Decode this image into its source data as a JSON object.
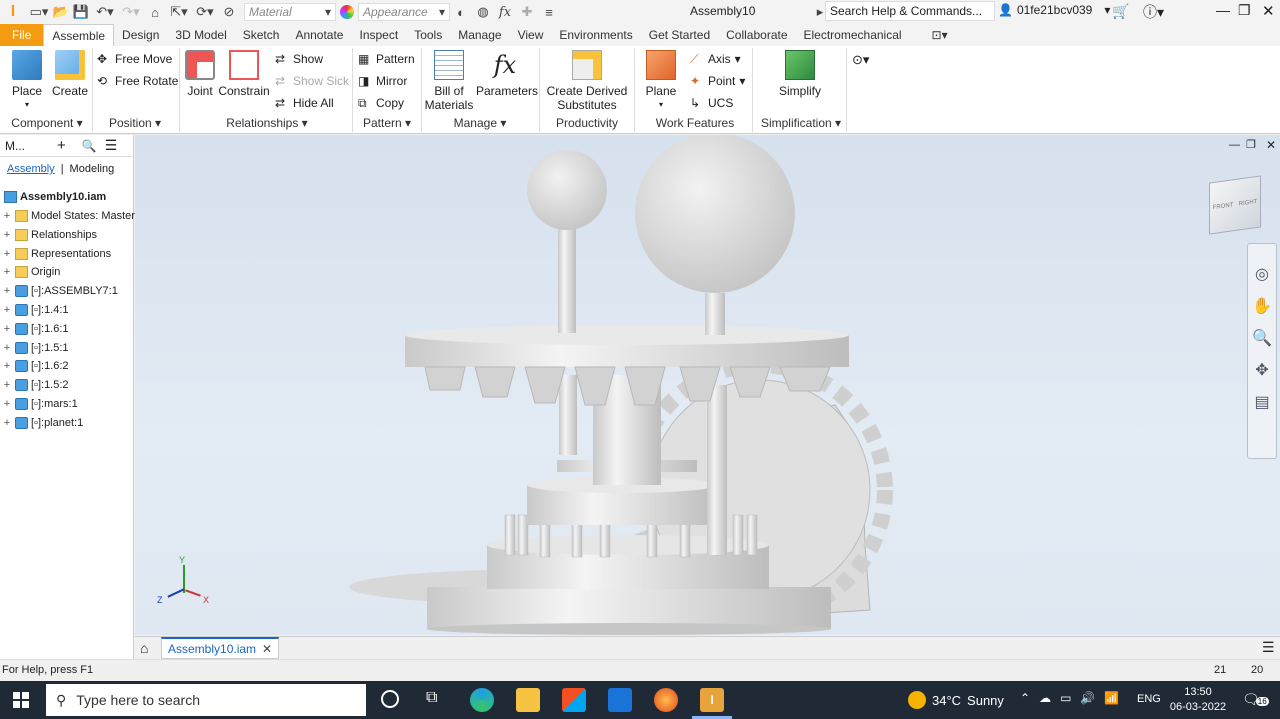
{
  "titlebar": {
    "material_placeholder": "Material",
    "appearance_placeholder": "Appearance",
    "document_title": "Assembly10",
    "search_placeholder": "Search Help & Commands...",
    "username": "01fe21bcv039"
  },
  "tabs": [
    "File",
    "Assemble",
    "Design",
    "3D Model",
    "Sketch",
    "Annotate",
    "Inspect",
    "Tools",
    "Manage",
    "View",
    "Environments",
    "Get Started",
    "Collaborate",
    "Electromechanical"
  ],
  "ribbon": {
    "component": {
      "place": "Place",
      "create": "Create",
      "group": "Component"
    },
    "position": {
      "free_move": "Free Move",
      "free_rotate": "Free Rotate",
      "group": "Position"
    },
    "relationships": {
      "joint": "Joint",
      "constrain": "Constrain",
      "show": "Show",
      "show_sick": "Show Sick",
      "hide_all": "Hide All",
      "group": "Relationships"
    },
    "pattern": {
      "pattern": "Pattern",
      "mirror": "Mirror",
      "copy": "Copy",
      "group": "Pattern"
    },
    "manage": {
      "bom_line1": "Bill of",
      "bom_line2": "Materials",
      "parameters": "Parameters",
      "group": "Manage"
    },
    "productivity": {
      "line1": "Create Derived",
      "line2": "Substitutes",
      "group": "Productivity"
    },
    "work_features": {
      "plane": "Plane",
      "axis": "Axis",
      "point": "Point",
      "ucs": "UCS",
      "group": "Work Features"
    },
    "simplification": {
      "simplify": "Simplify",
      "group": "Simplification"
    }
  },
  "browser": {
    "title": "M...",
    "tab_assembly": "Assembly",
    "tab_modeling": "Modeling",
    "root": "Assembly10.iam",
    "items": [
      {
        "label": "Model States: Master",
        "type": "folder"
      },
      {
        "label": "Relationships",
        "type": "folder"
      },
      {
        "label": "Representations",
        "type": "folder"
      },
      {
        "label": "Origin",
        "type": "folder"
      },
      {
        "label": "[▫]:ASSEMBLY7:1",
        "type": "assembly"
      },
      {
        "label": "[▫]:1.4:1",
        "type": "part"
      },
      {
        "label": "[▫]:1.6:1",
        "type": "part"
      },
      {
        "label": "[▫]:1.5:1",
        "type": "part"
      },
      {
        "label": "[▫]:1.6:2",
        "type": "part"
      },
      {
        "label": "[▫]:1.5:2",
        "type": "part"
      },
      {
        "label": "[▫]:mars:1",
        "type": "part"
      },
      {
        "label": "[▫]:planet:1",
        "type": "part"
      }
    ]
  },
  "viewcube": {
    "left": "FRONT",
    "right": "RIGHT"
  },
  "axes": {
    "x": "X",
    "y": "Y",
    "z": "Z"
  },
  "doc_tab": "Assembly10.iam",
  "status": {
    "help": "For Help, press F1",
    "n1": "21",
    "n2": "20"
  },
  "taskbar": {
    "search_placeholder": "Type here to search",
    "weather_temp": "34°C",
    "weather_desc": "Sunny",
    "lang": "ENG",
    "time": "13:50",
    "date": "06-03-2022",
    "notifications": "16"
  }
}
